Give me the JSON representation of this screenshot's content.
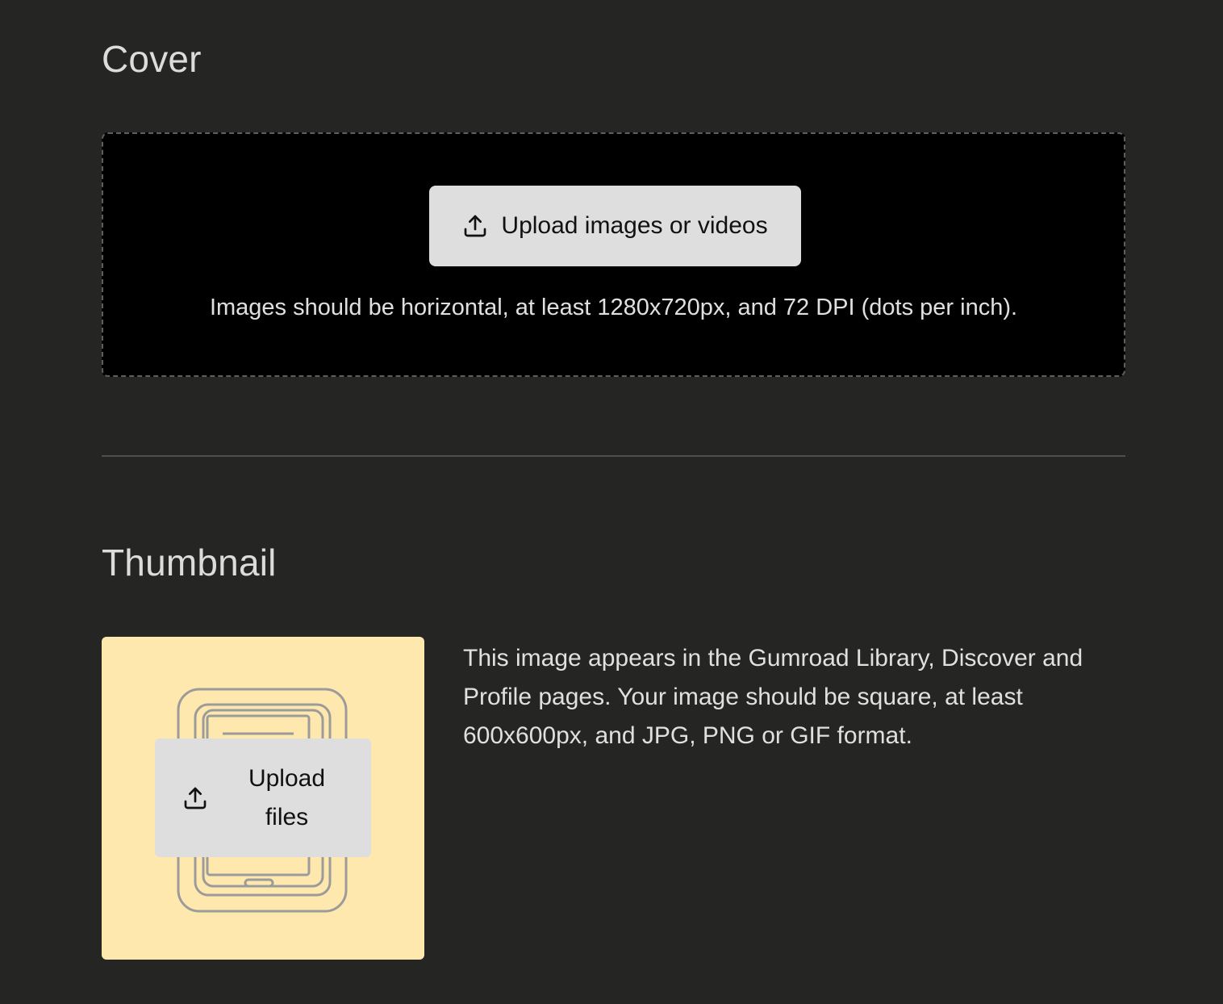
{
  "cover": {
    "title": "Cover",
    "upload_button_label": "Upload images or videos",
    "upload_icon": "upload-icon",
    "hint": "Images should be horizontal, at least 1280x720px, and 72 DPI (dots per inch)."
  },
  "thumbnail": {
    "title": "Thumbnail",
    "upload_button_label": "Upload files",
    "upload_icon": "upload-icon",
    "placeholder_illustration": "tablet-stack-illustration",
    "description": "This image appears in the Gumroad Library, Discover and Profile pages. Your image should be square, at least 600x600px, and JPG, PNG or GIF format."
  },
  "colors": {
    "background": "#252523",
    "dropzone": "#000000",
    "button": "#dedede",
    "thumbnail_placeholder": "#ffe8ad",
    "text": "#dcdcdc"
  }
}
